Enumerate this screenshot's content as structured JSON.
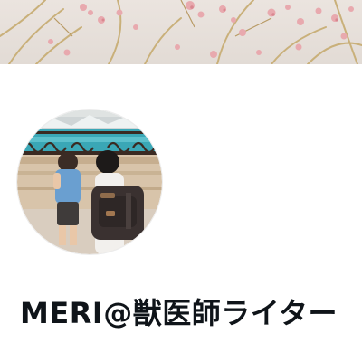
{
  "profile": {
    "display_name": "MERI@獣医師ライター"
  },
  "banner": {
    "description_icon": "cherry-blossom-banner-image"
  },
  "avatar": {
    "icon": "profile-photo-avatar"
  },
  "colors": {
    "name_text": "#0f1419",
    "background": "#ffffff",
    "banner_sky": "#e9e2dd",
    "blossom_pink": "#e8a9ae"
  }
}
